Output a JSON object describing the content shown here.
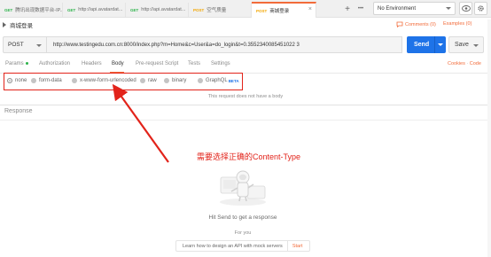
{
  "tabs": [
    {
      "method": "GET",
      "method_color": "#2cb34a",
      "name": "腾讯出现数据平台-IP..."
    },
    {
      "method": "GET",
      "method_color": "#2cb34a",
      "name": "http://api.avatardat..."
    },
    {
      "method": "GET",
      "method_color": "#2cb34a",
      "name": "http://api.avatardat..."
    },
    {
      "method": "POST",
      "method_color": "#f2a600",
      "name": "空气质量"
    },
    {
      "method": "POST",
      "method_color": "#f2a600",
      "name": "商城登录",
      "active": true
    }
  ],
  "tab_add_icon": "+",
  "tab_more_icon": "•••",
  "environment": {
    "selected": "No Environment"
  },
  "request": {
    "title": "商城登录",
    "comments_label": "Comments (0)",
    "examples_label": "Examples (0)",
    "method": "POST",
    "url": "http://www.testingedu.com.cn:8000/index.php?m=Home&c=User&a=do_login&t=0.3552340085451022 3",
    "send_label": "Send",
    "save_label": "Save"
  },
  "request_tabs": [
    {
      "label": "Params",
      "dot": true
    },
    {
      "label": "Authorization"
    },
    {
      "label": "Headers"
    },
    {
      "label": "Body",
      "selected": true
    },
    {
      "label": "Pre-request Script"
    },
    {
      "label": "Tests"
    },
    {
      "label": "Settings"
    }
  ],
  "links": {
    "cookies": "Cookies",
    "code": "Code",
    "separator": "·"
  },
  "body_types": [
    {
      "label": "none",
      "checked": true
    },
    {
      "label": "form-data"
    },
    {
      "label": "x-www-form-urlencoded"
    },
    {
      "label": "raw"
    },
    {
      "label": "binary"
    },
    {
      "label": "GraphQL",
      "badge": "BETA"
    }
  ],
  "no_body_message": "This request does not have a body",
  "response": {
    "label": "Response",
    "hit_send": "Hit Send to get a response",
    "for_you": "For you",
    "learn_text": "Learn how to design an API with mock servers",
    "start_label": "Start"
  },
  "annotation": {
    "text": "需要选择正确的Content-Type",
    "color": "#e2231a"
  },
  "colors": {
    "accent": "#f26b3a",
    "send": "#1e73e8",
    "highlight": "#e2231a"
  }
}
